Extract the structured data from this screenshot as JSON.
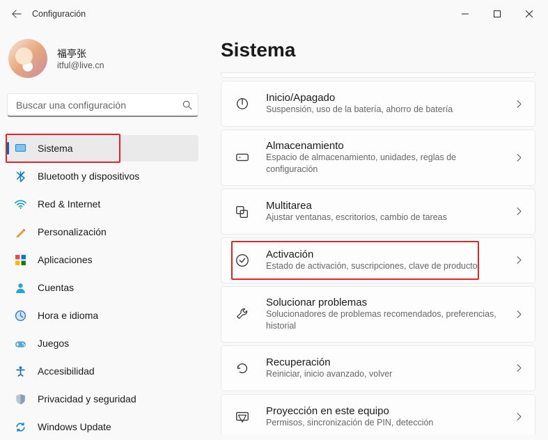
{
  "titlebar": {
    "title": "Configuración"
  },
  "profile": {
    "name": "福亭张",
    "email": "itful@live.cn"
  },
  "search": {
    "placeholder": "Buscar una configuración"
  },
  "nav": [
    {
      "id": "sistema",
      "label": "Sistema",
      "selected": true,
      "highlight": true
    },
    {
      "id": "bluetooth",
      "label": "Bluetooth y dispositivos"
    },
    {
      "id": "red",
      "label": "Red & Internet"
    },
    {
      "id": "personalizacion",
      "label": "Personalización"
    },
    {
      "id": "aplicaciones",
      "label": "Aplicaciones"
    },
    {
      "id": "cuentas",
      "label": "Cuentas"
    },
    {
      "id": "hora",
      "label": "Hora e idioma"
    },
    {
      "id": "juegos",
      "label": "Juegos"
    },
    {
      "id": "accesibilidad",
      "label": "Accesibilidad"
    },
    {
      "id": "privacidad",
      "label": "Privacidad y seguridad"
    },
    {
      "id": "update",
      "label": "Windows Update"
    }
  ],
  "main": {
    "title": "Sistema",
    "cards": [
      {
        "id": "power",
        "title": "Inicio/Apagado",
        "sub": "Suspensión, uso de la batería, ahorro de batería"
      },
      {
        "id": "storage",
        "title": "Almacenamiento",
        "sub": "Espacio de almacenamiento, unidades, reglas de configuración"
      },
      {
        "id": "multitask",
        "title": "Multitarea",
        "sub": "Ajustar ventanas, escritorios, cambio de tareas"
      },
      {
        "id": "activation",
        "title": "Activación",
        "sub": "Estado de activación, suscripciones, clave de producto",
        "highlight": true
      },
      {
        "id": "troubleshoot",
        "title": "Solucionar problemas",
        "sub": "Solucionadores de problemas recomendados, preferencias, historial"
      },
      {
        "id": "recovery",
        "title": "Recuperación",
        "sub": "Reiniciar, inicio avanzado, volver"
      },
      {
        "id": "projecting",
        "title": "Proyección en este equipo",
        "sub": "Permisos, sincronización de PIN, detección"
      }
    ]
  }
}
